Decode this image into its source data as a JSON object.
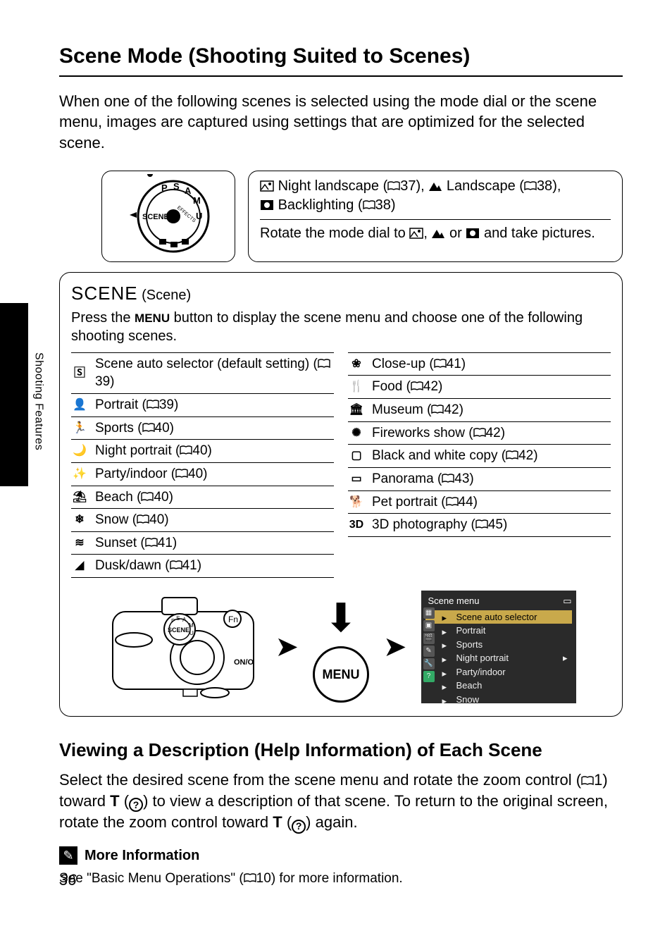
{
  "page_number": "36",
  "side_label": "Shooting Features",
  "title": "Scene Mode (Shooting Suited to Scenes)",
  "intro": "When one of the following scenes is selected using the mode dial or the scene menu, images are captured using settings that are optimized for the selected scene.",
  "dial_top": {
    "night_landscape": "Night landscape",
    "night_landscape_ref": "37",
    "landscape": "Landscape",
    "landscape_ref": "38",
    "backlighting": "Backlighting",
    "backlighting_ref": "38"
  },
  "dial_bottom": {
    "prefix": "Rotate the mode dial to",
    "suffix": "and take pictures.",
    "or": "or",
    "comma": ","
  },
  "scene_heading_word": "SCENE",
  "scene_heading_paren": "(Scene)",
  "scene_sub_a": "Press the ",
  "scene_sub_menu": "MENU",
  "scene_sub_b": " button to display the scene menu and choose one of the following shooting scenes.",
  "scenes_left": [
    {
      "icon": "🅂",
      "label": "Scene auto selector (default setting)",
      "ref": "39"
    },
    {
      "icon": "👤",
      "label": "Portrait",
      "ref": "39"
    },
    {
      "icon": "🏃",
      "label": "Sports",
      "ref": "40"
    },
    {
      "icon": "🌙",
      "label": "Night portrait",
      "ref": "40"
    },
    {
      "icon": "✨",
      "label": "Party/indoor",
      "ref": "40"
    },
    {
      "icon": "⛱",
      "label": "Beach",
      "ref": "40"
    },
    {
      "icon": "❄",
      "label": "Snow",
      "ref": "40"
    },
    {
      "icon": "≋",
      "label": "Sunset",
      "ref": "41"
    },
    {
      "icon": "◢",
      "label": "Dusk/dawn",
      "ref": "41"
    }
  ],
  "scenes_right": [
    {
      "icon": "❀",
      "label": "Close-up",
      "ref": "41"
    },
    {
      "icon": "🍴",
      "label": "Food",
      "ref": "42"
    },
    {
      "icon": "🏛",
      "label": "Museum",
      "ref": "42"
    },
    {
      "icon": "✺",
      "label": "Fireworks show",
      "ref": "42"
    },
    {
      "icon": "▢",
      "label": "Black and white copy",
      "ref": "42"
    },
    {
      "icon": "▭",
      "label": "Panorama",
      "ref": "43"
    },
    {
      "icon": "🐕",
      "label": "Pet portrait",
      "ref": "44"
    },
    {
      "icon": "3D",
      "label": "3D photography",
      "ref": "45"
    }
  ],
  "menu_button_label": "MENU",
  "lcd": {
    "title": "Scene menu",
    "items": [
      "Scene auto selector",
      "Portrait",
      "Sports",
      "Night portrait",
      "Party/indoor",
      "Beach",
      "Snow"
    ],
    "selected_index": 0
  },
  "help_heading": "Viewing a Description (Help Information) of Each Scene",
  "help": {
    "a": "Select the desired scene from the scene menu and rotate the zoom control (",
    "ref1": "1",
    "b": ") toward ",
    "t1": "T",
    "c": " (",
    "d": ") to view a description of that scene. To return to the original screen, rotate the zoom control toward ",
    "t2": "T",
    "e": " (",
    "f": ") again."
  },
  "note_title": "More Information",
  "note_body_a": "See \"Basic Menu Operations\" (",
  "note_ref": "10",
  "note_body_b": ") for more information."
}
